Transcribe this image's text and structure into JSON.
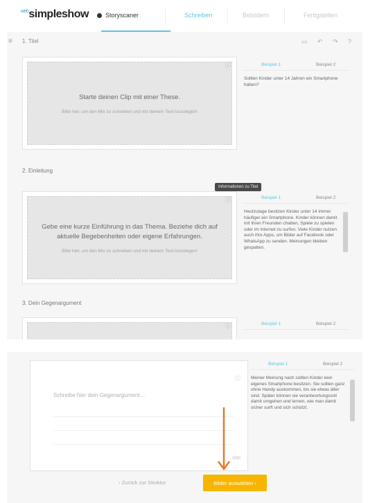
{
  "app": {
    "logo_prefix": "web",
    "logo": "simpleshow"
  },
  "nav": {
    "tabs": [
      {
        "label": "Storyscaner"
      },
      {
        "label": "Schreiben"
      },
      {
        "label": "Bebildern"
      },
      {
        "label": "Fertigstellen"
      }
    ]
  },
  "header": {
    "menu_icon": "hamburger-icon",
    "title": "1. Titel",
    "tools": "▭ ↶ ↷ ?"
  },
  "sections": [
    {
      "title": "1. Titel",
      "box_big": "Starte deinen Clip mit einer These.",
      "box_small": "Bitte hier, um den Mix zu schreiben und mit deinem Text loszulegen!",
      "side_tab1": "Beispiel 1",
      "side_tab2": "Beispiel 2",
      "side_text": "Sollten Kinder unter 14 Jahren ein Smartphone haben?"
    },
    {
      "title": "2. Einleitung",
      "box_big": "Gebe eine kurze Einführung in das Thema. Beziehe dich auf aktuelle Begebenheiten oder eigene Erfahrungen.",
      "box_small": "Bitte hier, um den Mix zu schreiben und mit deinem Text loszulegen!",
      "side_tab1": "Beispiel 1",
      "side_tab2": "Beispiel 2",
      "side_text": "Heutzutage besitzen Kinder unter 14 immer häufiger ein Smartphone. Kinder können damit mit ihren Freunden chatten, Spiele zu spielen oder im Internet zu surfen. Viele Kinder nutzen auch ihre Apps, um Bilder auf Facebook oder WhatsApp zu senden. Meinungen bleiben gespalten."
    },
    {
      "title": "3. Dein Gegenargument",
      "side_tab1": "Beispiel 1",
      "side_tab2": "Beispiel 2"
    }
  ],
  "tooltip": "Informationen zu Titel",
  "editor": {
    "placeholder": "Schreibe hier dein Gegenargument…",
    "counter": "0/80",
    "side_tab1": "Beispiel 1",
    "side_tab2": "Beispiel 2",
    "side_text": "Meiner Meinung nach sollten Kinder kein eigenes Smartphone besitzen. Sie sollten ganz ohne Handy auskommen, bis sie etwas älter sind. Später können sie verantwortungsvoll damit umgehen und lernen, wie man damit sicher surft und sich schützt."
  },
  "footer": {
    "back": "‹ Zurück zur Struktur",
    "next": "Bilder auswählen ›"
  },
  "colors": {
    "accent": "#5dc5e0",
    "button": "#f7b500",
    "arrow": "#e8782a"
  }
}
